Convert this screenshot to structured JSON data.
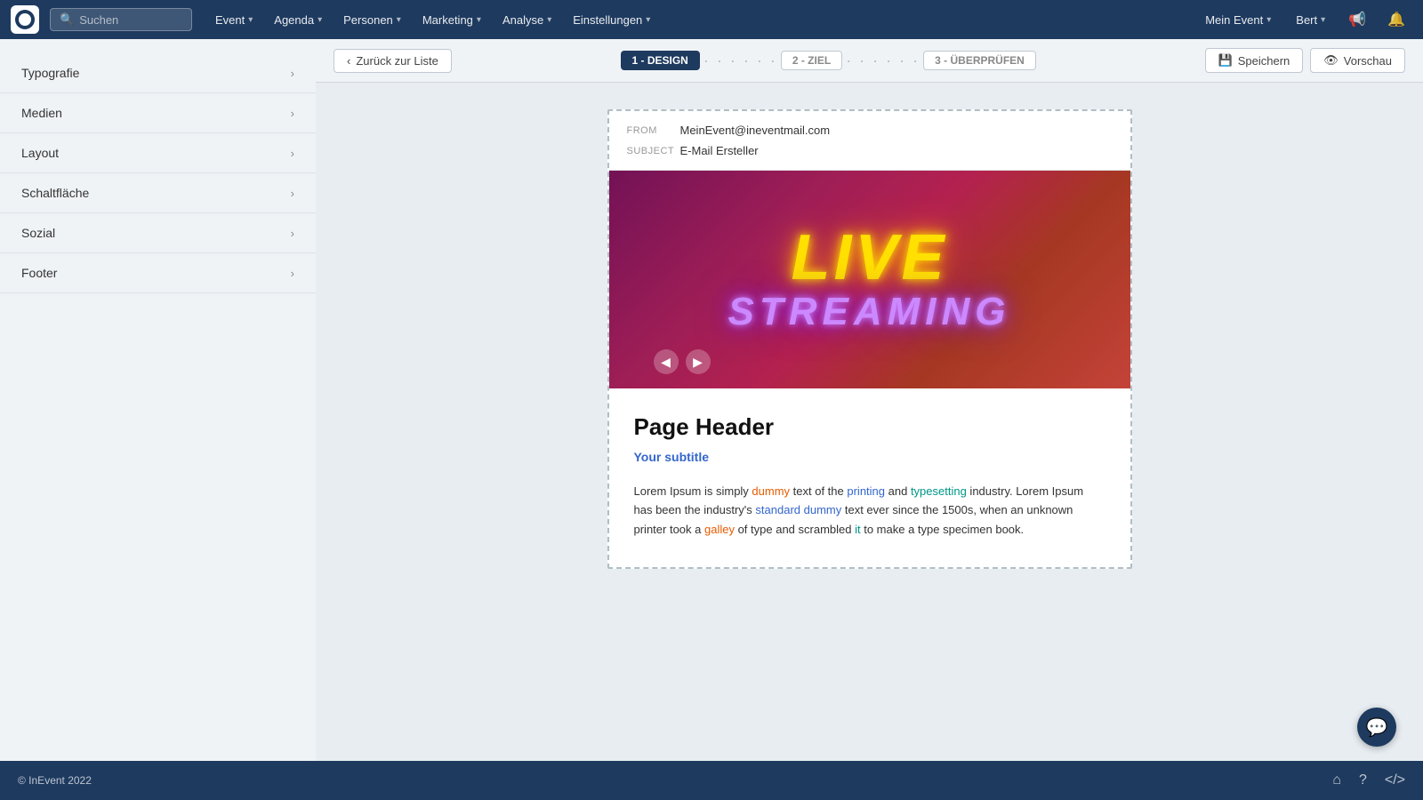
{
  "topnav": {
    "search_placeholder": "Suchen",
    "nav_items": [
      {
        "id": "event",
        "label": "Event"
      },
      {
        "id": "agenda",
        "label": "Agenda"
      },
      {
        "id": "personen",
        "label": "Personen"
      },
      {
        "id": "marketing",
        "label": "Marketing"
      },
      {
        "id": "analyse",
        "label": "Analyse"
      },
      {
        "id": "einstellungen",
        "label": "Einstellungen"
      }
    ],
    "right_label": "Mein Event",
    "user_label": "Bert"
  },
  "subtoolbar": {
    "back_label": "Zurück zur Liste",
    "steps": [
      {
        "id": "design",
        "label": "1 - DESIGN",
        "active": true
      },
      {
        "id": "ziel",
        "label": "2 - ZIEL",
        "active": false
      },
      {
        "id": "ueberpruefen",
        "label": "3 - ÜBERPRÜFEN",
        "active": false
      }
    ],
    "save_label": "Speichern",
    "preview_label": "Vorschau"
  },
  "sidebar": {
    "items": [
      {
        "id": "typografie",
        "label": "Typografie"
      },
      {
        "id": "medien",
        "label": "Medien"
      },
      {
        "id": "layout",
        "label": "Layout"
      },
      {
        "id": "schaltflaeche",
        "label": "Schaltfläche"
      },
      {
        "id": "sozial",
        "label": "Sozial"
      },
      {
        "id": "footer",
        "label": "Footer"
      }
    ]
  },
  "email": {
    "from_label": "FROM",
    "from_value": "MeinEvent@ineventmail.com",
    "subject_label": "SUBJECT",
    "subject_value": "E-Mail Ersteller",
    "hero_live": "LIVE",
    "hero_streaming": "STREAMING",
    "page_header": "Page Header",
    "subtitle": "Your subtitle",
    "body_text": "Lorem Ipsum is simply dummy text of the printing and typesetting industry. Lorem Ipsum has been the industry's standard dummy text ever since the 1500s, when an unknown printer took a galley of type and scrambled it to make a type specimen book."
  },
  "footer": {
    "copyright": "© InEvent 2022"
  }
}
